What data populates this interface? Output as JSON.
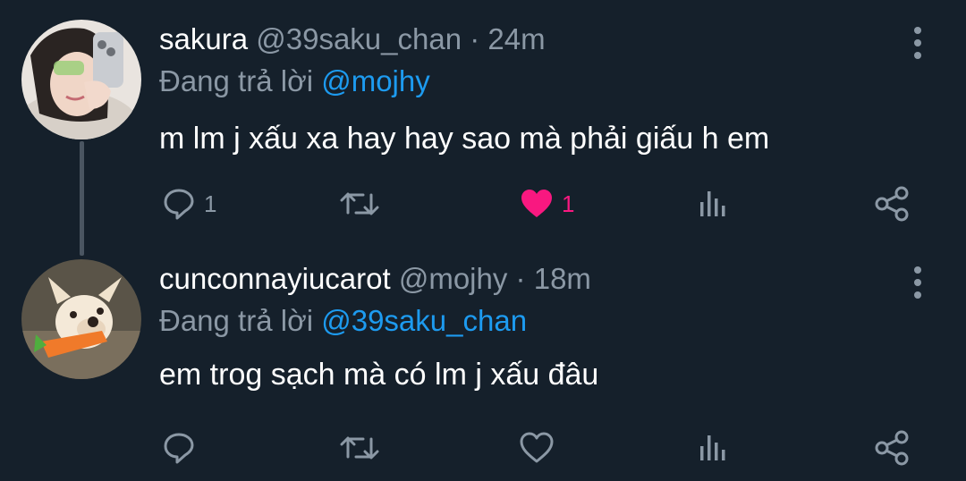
{
  "tweets": [
    {
      "name": "sakura",
      "handle": "@39saku_chan",
      "dot": "·",
      "time": "24m",
      "reply_prefix": "Đang trả lời",
      "reply_to": "@mojhy",
      "text": "m lm j xấu xa hay hay sao mà phải giấu h em",
      "reply_count": "1",
      "like_count": "1",
      "liked": true
    },
    {
      "name": "cunconnayiucarot",
      "handle": "@mojhy",
      "dot": "·",
      "time": "18m",
      "reply_prefix": "Đang trả lời",
      "reply_to": "@39saku_chan",
      "text": "em trog sạch mà có lm j xấu đâu",
      "reply_count": "",
      "like_count": "",
      "liked": false
    }
  ],
  "colors": {
    "background": "#15202b",
    "secondary_text": "#8b98a5",
    "mention": "#1d9bf0",
    "like": "#f91880"
  },
  "icons": [
    "reply-icon",
    "retweet-icon",
    "like-icon",
    "views-icon",
    "share-icon",
    "more-icon"
  ]
}
